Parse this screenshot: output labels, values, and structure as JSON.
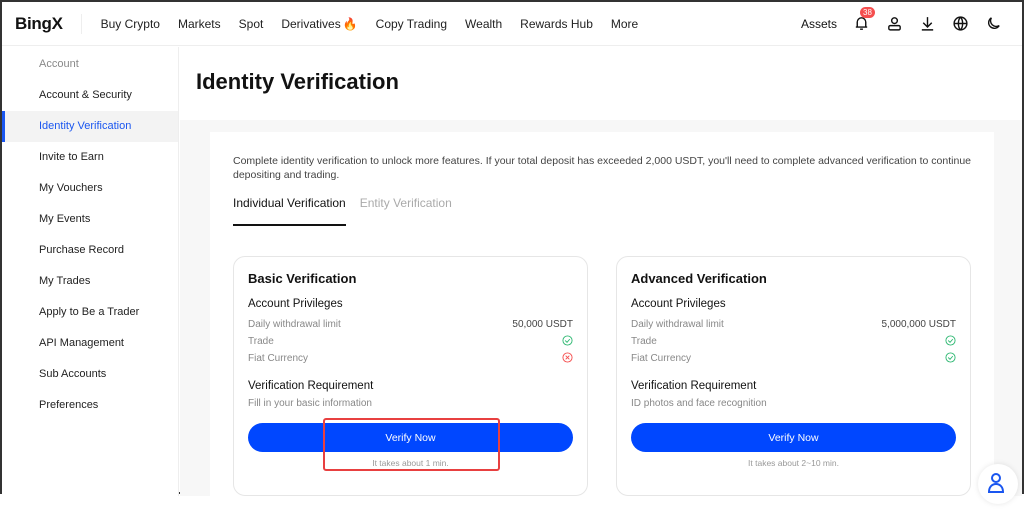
{
  "header": {
    "logo": "BingX",
    "nav": [
      "Buy Crypto",
      "Markets",
      "Spot",
      "Derivatives",
      "Copy Trading",
      "Wealth",
      "Rewards Hub",
      "More"
    ],
    "assets": "Assets",
    "notification_count": "38"
  },
  "sidebar": {
    "heading": "Account",
    "items": [
      "Account & Security",
      "Identity Verification",
      "Invite to Earn",
      "My Vouchers",
      "My Events",
      "Purchase Record",
      "My Trades",
      "Apply to Be a Trader",
      "API Management",
      "Sub Accounts",
      "Preferences"
    ],
    "active": "Identity Verification"
  },
  "main": {
    "title": "Identity Verification",
    "intro": "Complete identity verification to unlock more features. If your total deposit has exceeded 2,000 USDT, you'll need to complete advanced verification to continue depositing and trading.",
    "tabs": [
      "Individual Verification",
      "Entity Verification"
    ],
    "cards": [
      {
        "title": "Basic Verification",
        "privileges_label": "Account Privileges",
        "rows": [
          {
            "label": "Daily withdrawal limit",
            "value": "50,000 USDT"
          },
          {
            "label": "Trade",
            "value": "check"
          },
          {
            "label": "Fiat Currency",
            "value": "cross"
          }
        ],
        "req_label": "Verification Requirement",
        "req": "Fill in your basic information",
        "button": "Verify Now",
        "note": "It takes about 1 min."
      },
      {
        "title": "Advanced Verification",
        "privileges_label": "Account Privileges",
        "rows": [
          {
            "label": "Daily withdrawal limit",
            "value": "5,000,000 USDT"
          },
          {
            "label": "Trade",
            "value": "check"
          },
          {
            "label": "Fiat Currency",
            "value": "check"
          }
        ],
        "req_label": "Verification Requirement",
        "req": "ID photos and face recognition",
        "button": "Verify Now",
        "note": "It takes about 2~10 min."
      }
    ]
  },
  "colors": {
    "accent": "#0047ff",
    "success": "#2eb872",
    "error": "#f54e4e",
    "highlight": "#e84040"
  }
}
